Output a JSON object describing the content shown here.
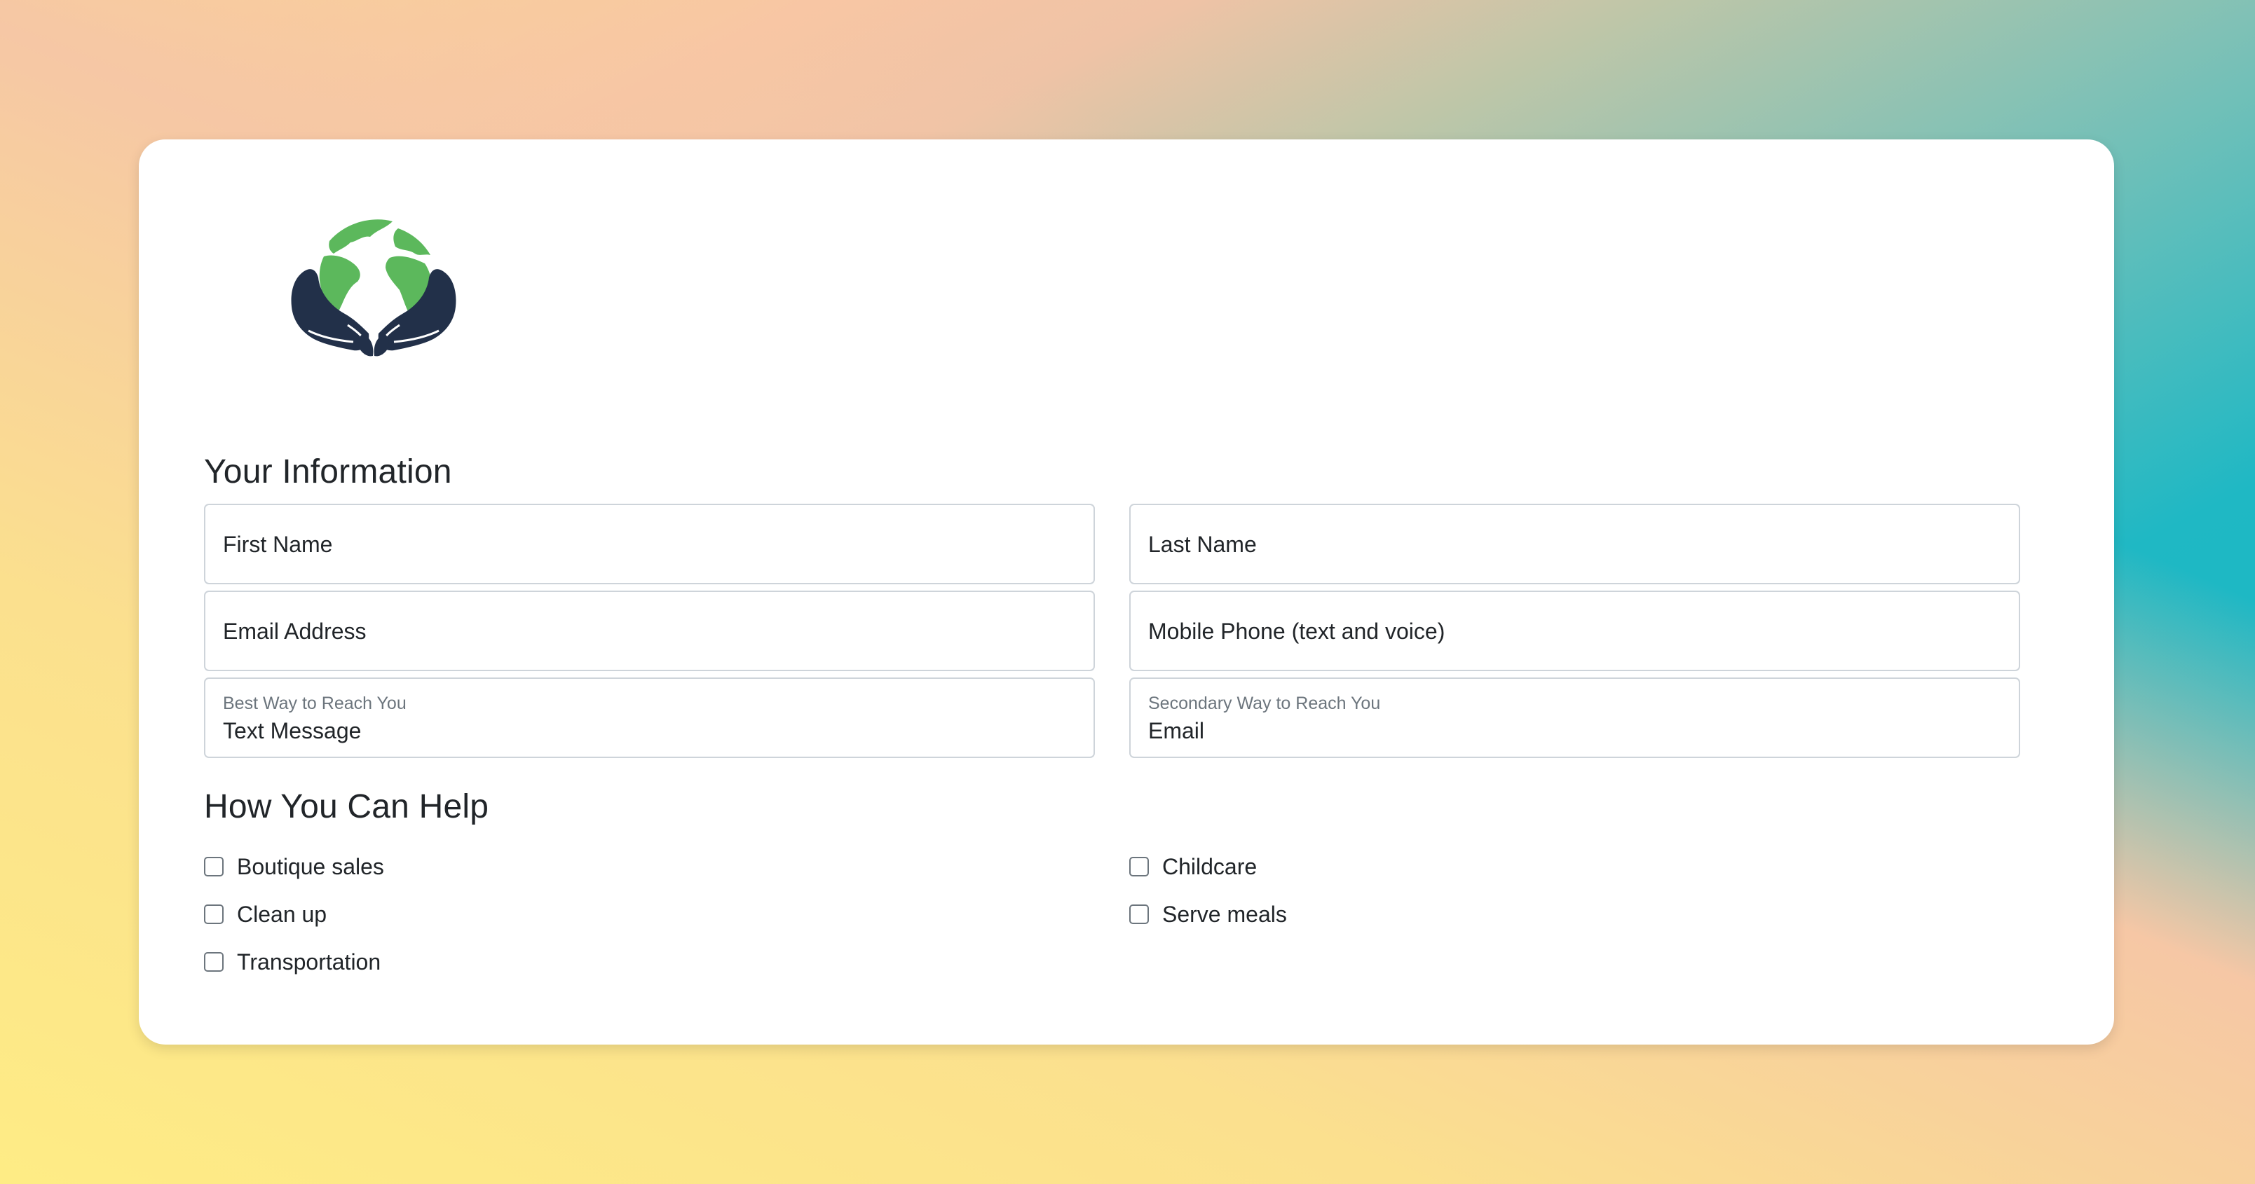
{
  "logo": {
    "icon": "globe-in-hands-icon",
    "colors": {
      "land": "#5cb85c",
      "hands": "#223049",
      "ocean": "#ffffff"
    }
  },
  "your_information": {
    "heading": "Your Information",
    "first_name_placeholder": "First Name",
    "last_name_placeholder": "Last Name",
    "email_placeholder": "Email Address",
    "phone_placeholder": "Mobile Phone (text and voice)",
    "best_way": {
      "label": "Best Way to Reach You",
      "value": "Text Message"
    },
    "secondary_way": {
      "label": "Secondary Way to Reach You",
      "value": "Email"
    }
  },
  "how_you_can_help": {
    "heading": "How You Can Help",
    "options": [
      {
        "label": "Boutique sales",
        "checked": false
      },
      {
        "label": "Childcare",
        "checked": false
      },
      {
        "label": "Clean up",
        "checked": false
      },
      {
        "label": "Serve meals",
        "checked": false
      },
      {
        "label": "Transportation",
        "checked": false
      }
    ]
  },
  "theme": {
    "border": "#ced4da",
    "muted_text": "#6c757d",
    "text": "#212529"
  }
}
